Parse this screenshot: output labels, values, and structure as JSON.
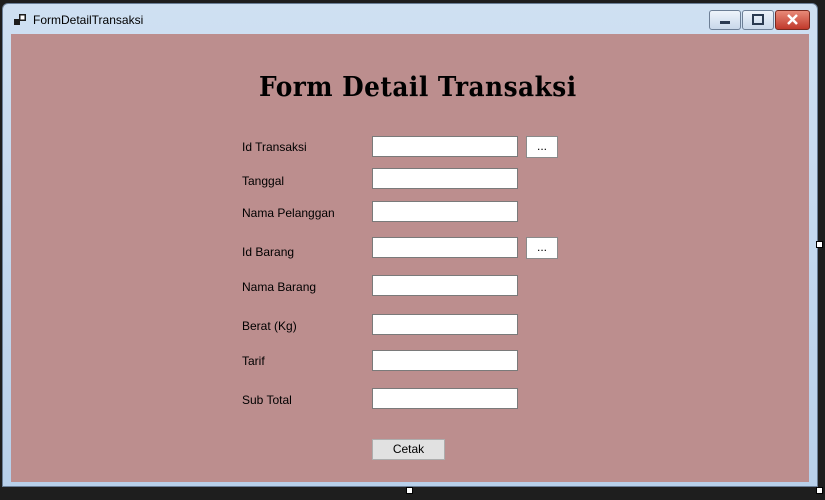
{
  "window": {
    "title": "FormDetailTransaksi"
  },
  "form": {
    "heading": "Form Detail Transaksi",
    "fields": [
      {
        "label": "Id Transaksi",
        "value": "",
        "has_browse": true
      },
      {
        "label": "Tanggal",
        "value": "",
        "has_browse": false
      },
      {
        "label": "Nama Pelanggan",
        "value": "",
        "has_browse": false
      },
      {
        "label": "Id Barang",
        "value": "",
        "has_browse": true
      },
      {
        "label": "Nama Barang",
        "value": "",
        "has_browse": false
      },
      {
        "label": "Berat (Kg)",
        "value": "",
        "has_browse": false
      },
      {
        "label": "Tarif",
        "value": "",
        "has_browse": false
      },
      {
        "label": "Sub Total",
        "value": "",
        "has_browse": false
      }
    ],
    "browse_label": "...",
    "print_button": "Cetak"
  },
  "colors": {
    "form_background": "#bc8e8e"
  }
}
